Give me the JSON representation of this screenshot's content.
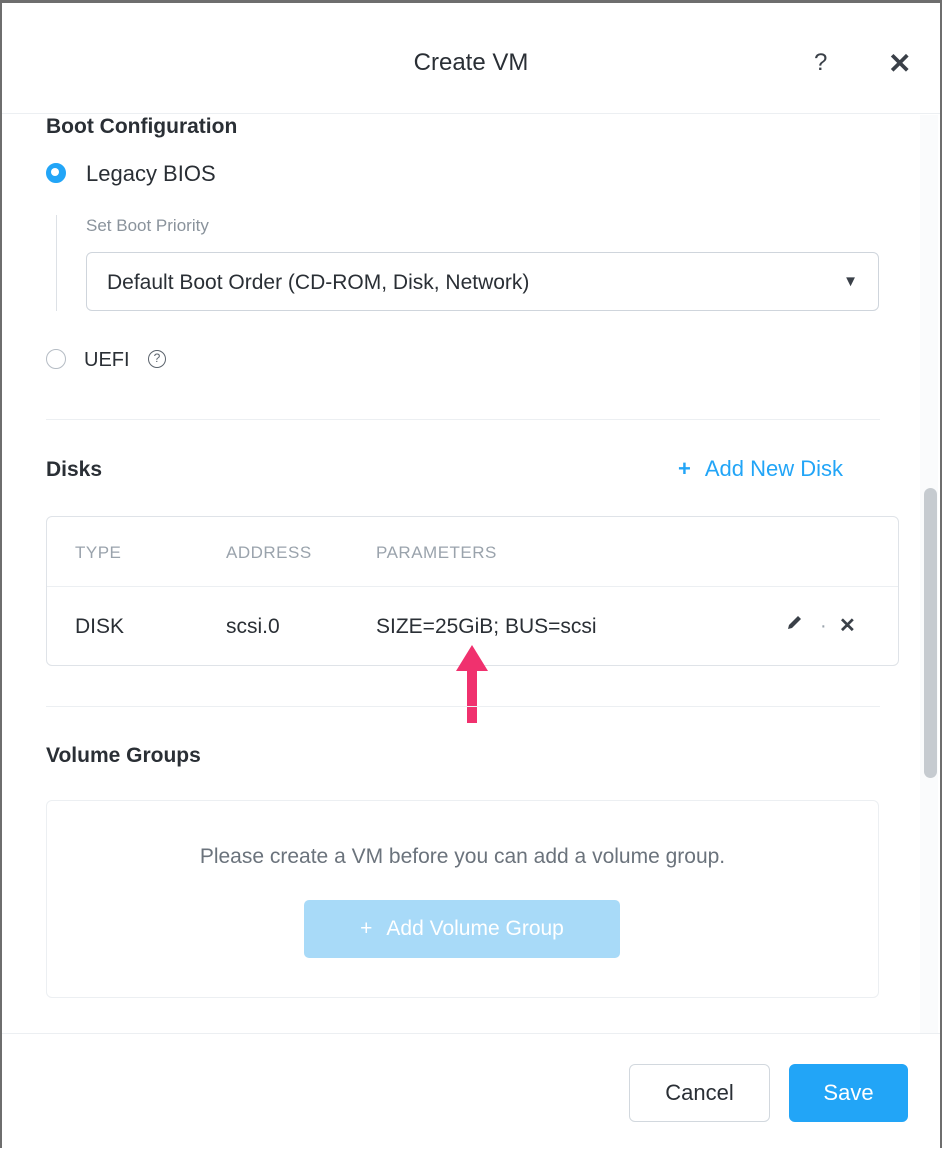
{
  "dialog": {
    "title": "Create VM",
    "help_label": "?",
    "close_label": "✕"
  },
  "boot": {
    "section_title": "Boot Configuration",
    "legacy_label": "Legacy BIOS",
    "priority_label": "Set Boot Priority",
    "priority_value": "Default Boot Order (CD-ROM, Disk, Network)",
    "uefi_label": "UEFI",
    "selected": "legacy"
  },
  "disks": {
    "section_title": "Disks",
    "add_label": "Add New Disk",
    "columns": [
      "TYPE",
      "ADDRESS",
      "PARAMETERS"
    ],
    "rows": [
      {
        "type": "DISK",
        "address": "scsi.0",
        "parameters": "SIZE=25GiB; BUS=scsi"
      }
    ]
  },
  "volume_groups": {
    "section_title": "Volume Groups",
    "empty_message": "Please create a VM before you can add a volume group.",
    "add_label": "Add Volume Group"
  },
  "footer": {
    "cancel_label": "Cancel",
    "save_label": "Save"
  },
  "colors": {
    "accent": "#22a5f7",
    "annotation_arrow": "#f0316e"
  },
  "icons": {
    "edit": "pencil-icon",
    "delete": "close-icon",
    "add": "plus-icon",
    "caret": "chevron-down-icon",
    "help": "question-circle-icon"
  }
}
